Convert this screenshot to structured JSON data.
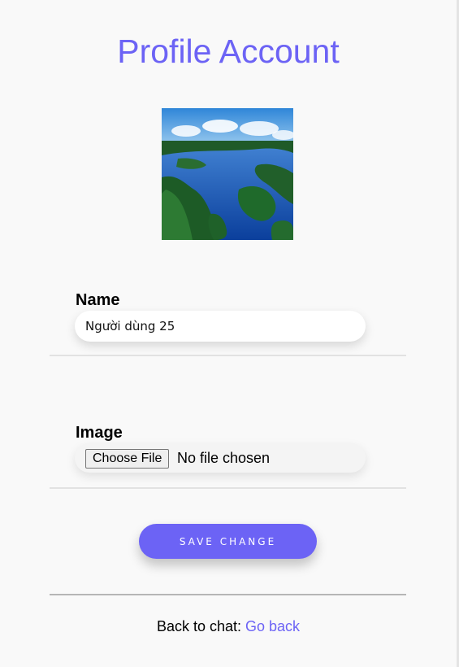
{
  "header": {
    "title": "Profile Account"
  },
  "avatar": {
    "description_icon": "lake-forest-photo"
  },
  "form": {
    "name_label": "Name",
    "name_value": "Người dùng 25",
    "image_label": "Image",
    "file_button_label": "Choose File",
    "file_status": "No file chosen",
    "save_label": "SAVE CHANGE"
  },
  "footer": {
    "back_text": "Back to chat:",
    "back_link": "Go back"
  },
  "colors": {
    "accent": "#6c63f5",
    "background": "#f9f9f9"
  }
}
